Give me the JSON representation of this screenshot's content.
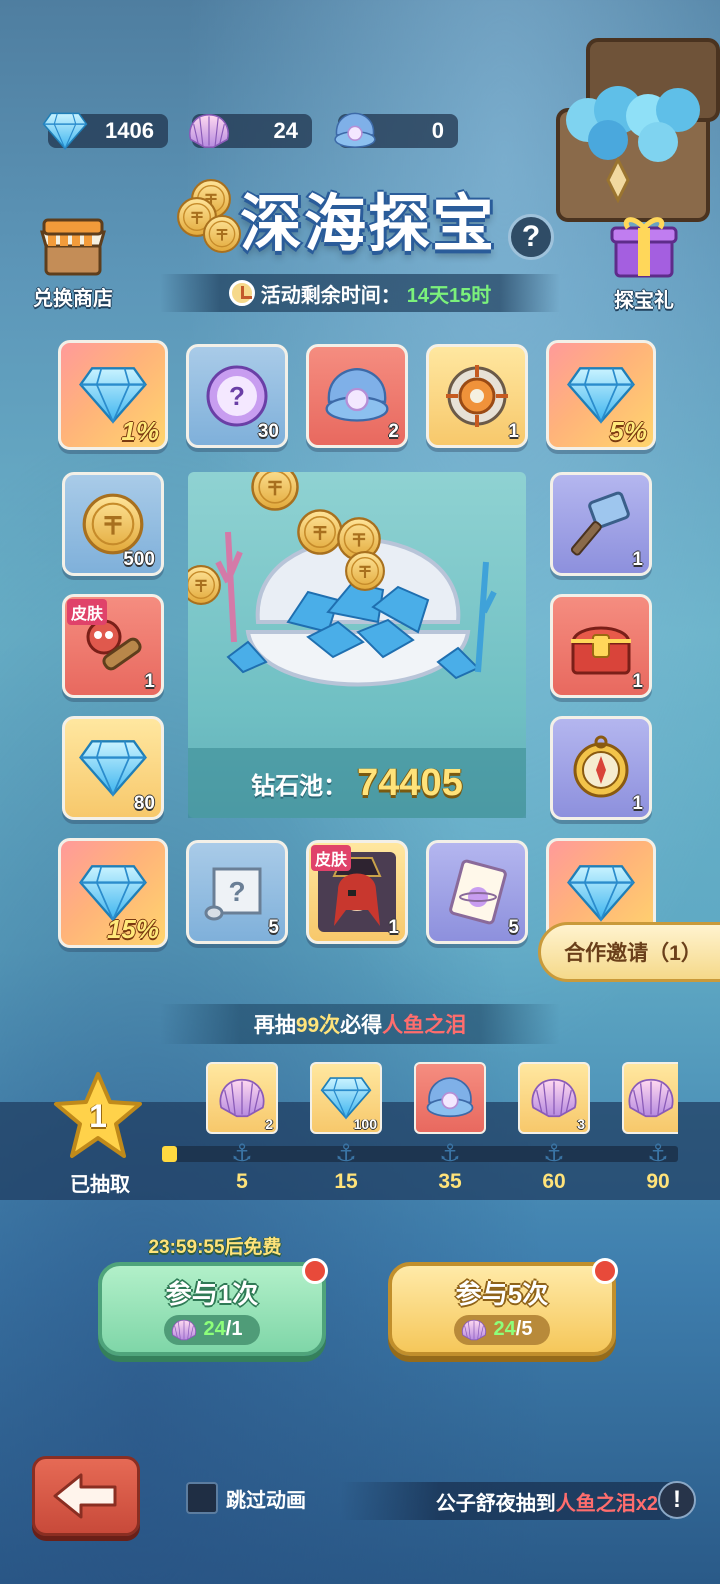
{
  "currencies": {
    "diamond": "1406",
    "shell": "24",
    "pearl": "0"
  },
  "title": "深海探宝",
  "help_symbol": "?",
  "shop_label": "兑换商店",
  "gift_label": "探宝礼",
  "timer": {
    "label": "活动剩余时间：",
    "value": "14天15时"
  },
  "grid": [
    {
      "id": "r1c1",
      "icon": "diamond-icon",
      "badge": "1%"
    },
    {
      "id": "r1c2",
      "icon": "mystery-orb-icon",
      "qty": "30"
    },
    {
      "id": "r1c3",
      "icon": "pearl-shell-icon",
      "qty": "2"
    },
    {
      "id": "r1c4",
      "icon": "target-badge-icon",
      "qty": "1"
    },
    {
      "id": "r1c5",
      "icon": "diamond-icon",
      "badge": "5%"
    },
    {
      "id": "r2c1",
      "icon": "gold-coin-icon",
      "qty": "500"
    },
    {
      "id": "r2c5",
      "icon": "hammer-icon",
      "qty": "1"
    },
    {
      "id": "r3c1",
      "icon": "octopus-spyglass-icon",
      "qty": "1",
      "tag": "皮肤"
    },
    {
      "id": "r3c5",
      "icon": "treasure-chest-icon",
      "qty": "1"
    },
    {
      "id": "r4c1",
      "icon": "diamond-icon",
      "qty": "80"
    },
    {
      "id": "r4c5",
      "icon": "compass-icon",
      "qty": "1"
    },
    {
      "id": "r5c1",
      "icon": "diamond-icon",
      "badge": "15%"
    },
    {
      "id": "r5c2",
      "icon": "mystery-scroll-icon",
      "qty": "5"
    },
    {
      "id": "r5c3",
      "icon": "pirate-girl-icon",
      "qty": "1",
      "tag": "皮肤"
    },
    {
      "id": "r5c4",
      "icon": "integral-card-icon",
      "qty": "5"
    },
    {
      "id": "r5c5",
      "icon": "diamond-icon"
    }
  ],
  "pool": {
    "label": "钻石池：",
    "value": "74405"
  },
  "coop_button": "合作邀请（1）",
  "hint": {
    "prefix": "再抽",
    "count": "99次",
    "middle": "必得",
    "reward": "人鱼之泪"
  },
  "progress": {
    "drawn_count": "1",
    "drawn_label": "已抽取",
    "fill_fraction": 0.03,
    "milestones": [
      {
        "value": "5",
        "reward_icon": "shell-icon",
        "reward_qty": "2"
      },
      {
        "value": "15",
        "reward_icon": "diamond-icon",
        "reward_qty": "100"
      },
      {
        "value": "35",
        "reward_icon": "pearl-shell-icon",
        "reward_qty": ""
      },
      {
        "value": "60",
        "reward_icon": "shell-icon",
        "reward_qty": "3"
      },
      {
        "value": "90",
        "reward_icon": "shell-icon",
        "reward_qty": ""
      }
    ]
  },
  "free_timer": "23:59:55后免费",
  "play_once": {
    "label": "参与1次",
    "have": "24",
    "cost": "/1"
  },
  "play_five": {
    "label": "参与5次",
    "have": "24",
    "cost": "/5"
  },
  "skip_label": "跳过动画",
  "ticker": {
    "prefix": "公子舒夜抽到",
    "item": "人鱼之泪x2"
  },
  "info_symbol": "!",
  "colors": {
    "accent_gold": "#ffe37a",
    "timer_green": "#7bf17b",
    "highlight_red": "#ff6d6d"
  }
}
